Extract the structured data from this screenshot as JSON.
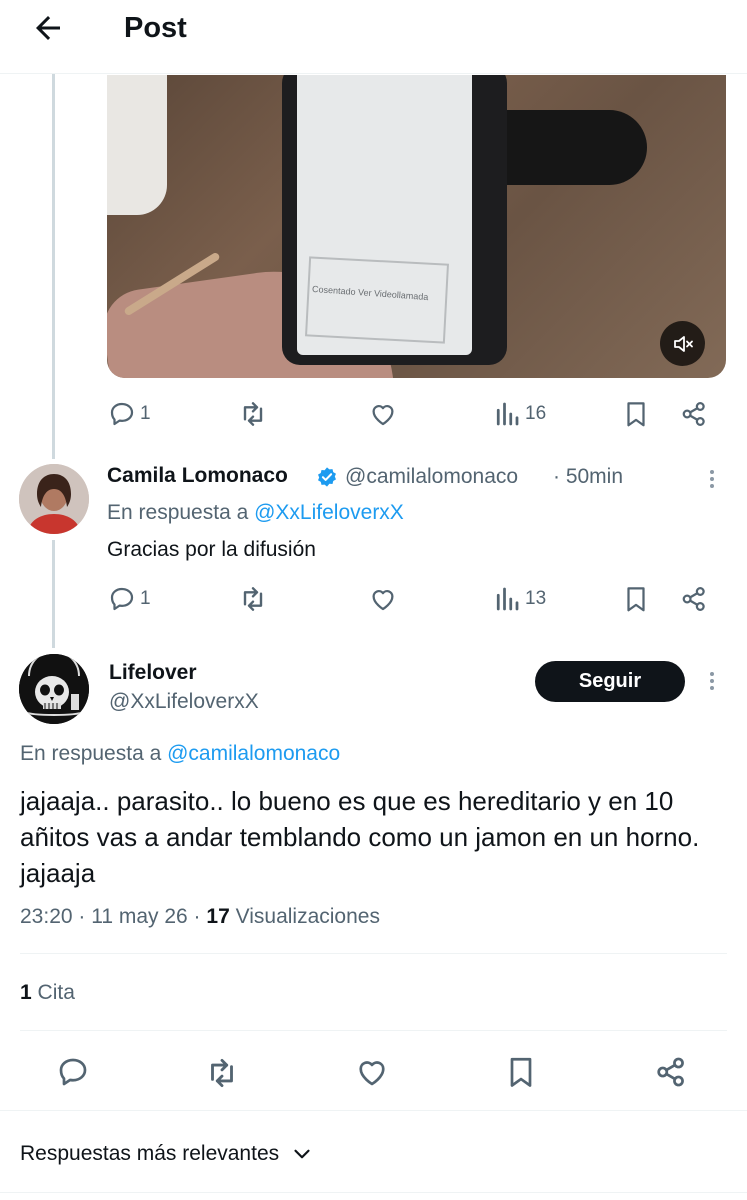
{
  "header": {
    "title": "Post"
  },
  "video": {
    "screen_text": "Cosentado Ver Videollamada"
  },
  "tweet1_actions": {
    "replies": "1",
    "views": "16"
  },
  "reply1": {
    "name": "Camila Lomonaco",
    "handle": "@camilalomonaco",
    "time": "· 50min",
    "reply_prefix": "En respuesta a",
    "reply_to": "@XxLifeloverxX",
    "text": "Gracias por la difusión",
    "replies": "1",
    "views": "13"
  },
  "main": {
    "name": "Lifelover",
    "handle": "@XxLifeloverxX",
    "follow_label": "Seguir",
    "reply_prefix": "En respuesta a",
    "reply_to": "@camilalomonaco",
    "text": "jajaaja.. parasito.. lo bueno es que es hereditario y en 10 añitos vas a andar temblando como un jamon en un horno. jajaaja",
    "time": "23:20 · 11 may 26 ·",
    "views_count": "17",
    "views_label": "Visualizaciones",
    "quotes_count": "1",
    "quotes_label": "Cita"
  },
  "sort": {
    "label": "Respuestas más relevantes"
  },
  "colors": {
    "verified": "#1d9bf0",
    "link": "#1d9bf0",
    "muted": "#536471",
    "follow_bg": "#0f1419"
  }
}
